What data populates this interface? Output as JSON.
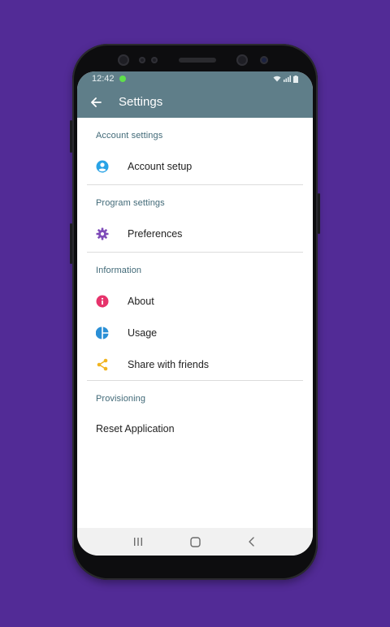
{
  "status_bar": {
    "time": "12:42"
  },
  "app_bar": {
    "title": "Settings"
  },
  "sections": [
    {
      "header": "Account settings",
      "items": [
        {
          "label": "Account setup",
          "icon": "account-circle-icon",
          "color": "#29a3e6"
        }
      ]
    },
    {
      "header": "Program settings",
      "items": [
        {
          "label": "Preferences",
          "icon": "gear-icon",
          "color": "#7e4bb8"
        }
      ]
    },
    {
      "header": "Information",
      "items": [
        {
          "label": "About",
          "icon": "info-icon",
          "color": "#e6336b"
        },
        {
          "label": "Usage",
          "icon": "pie-chart-icon",
          "color": "#2a8fd6"
        },
        {
          "label": "Share with friends",
          "icon": "share-icon",
          "color": "#f1b420"
        }
      ]
    },
    {
      "header": "Provisioning",
      "items": [
        {
          "label": "Reset Application"
        }
      ]
    }
  ],
  "colors": {
    "background": "#522b96",
    "app_bar": "#5f7e89",
    "section_header": "#426a78"
  }
}
